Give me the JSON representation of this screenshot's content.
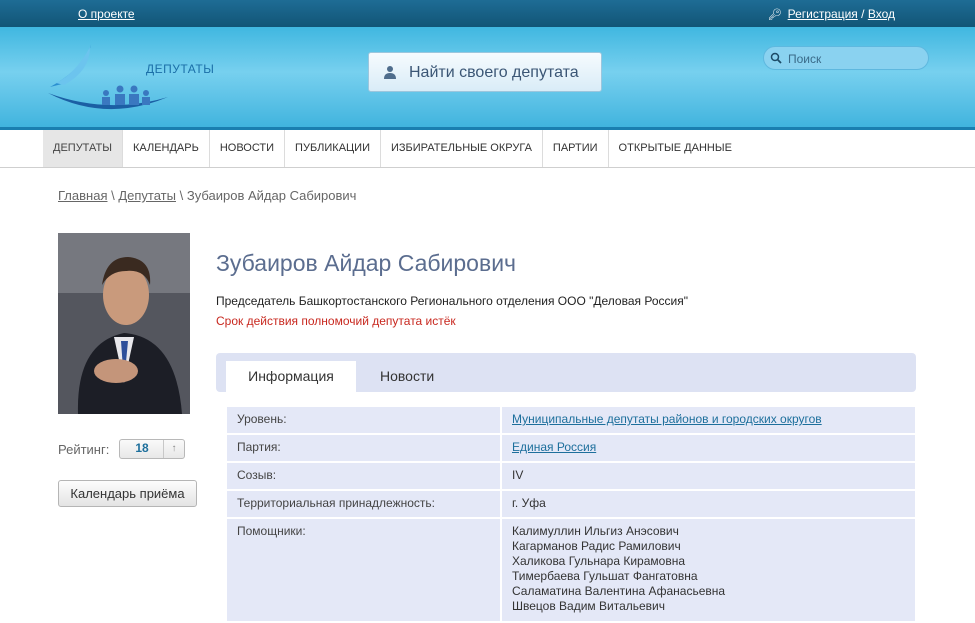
{
  "topbar": {
    "about": "О проекте",
    "register": "Регистрация",
    "separator": "/",
    "login": "Вход"
  },
  "header": {
    "logo_text": "ДЕПУТАТЫ",
    "find_button": "Найти своего депутата",
    "search_placeholder": "Поиск"
  },
  "nav": {
    "items": [
      "ДЕПУТАТЫ",
      "КАЛЕНДАРЬ",
      "НОВОСТИ",
      "ПУБЛИКАЦИИ",
      "ИЗБИРАТЕЛЬНЫЕ ОКРУГА",
      "ПАРТИИ",
      "ОТКРЫТЫЕ ДАННЫЕ"
    ],
    "active": 0
  },
  "breadcrumb": {
    "home": "Главная",
    "deputies": "Депутаты",
    "sep": "\\",
    "current": "Зубаиров Айдар Сабирович"
  },
  "profile": {
    "name": "Зубаиров Айдар Сабирович",
    "position": "Председатель Башкортостанского Регионального отделения ООО \"Деловая Россия\"",
    "status": "Срок действия полномочий депутата истёк",
    "rating_label": "Рейтинг:",
    "rating_value": "18",
    "calendar_button": "Календарь приёма"
  },
  "tabs": {
    "info": "Информация",
    "news": "Новости"
  },
  "info": {
    "level_label": "Уровень:",
    "level_value": "Муниципальные депутаты районов и городских округов",
    "party_label": "Партия:",
    "party_value": "Единая Россия",
    "convocation_label": "Созыв:",
    "convocation_value": "IV",
    "territory_label": "Территориальная принадлежность:",
    "territory_value": "г. Уфа",
    "assistants_label": "Помощники:",
    "assistants": [
      "Калимуллин Ильгиз Анэсович",
      "Кагарманов Радис Рамилович",
      "Халикова Гульнара Кирамовна",
      "Тимербаева Гульшат Фангатовна",
      "Саламатина Валентина Афанасьевна",
      "Швецов Вадим Витальевич"
    ]
  },
  "colors": {
    "topbar": "#125576",
    "header": "#41b4de",
    "link": "#1d6f9c",
    "name": "#5b6d8f",
    "expired": "#c8281f",
    "tabs_bg": "#dde2f3",
    "table_bg": "#e4e8f7"
  }
}
